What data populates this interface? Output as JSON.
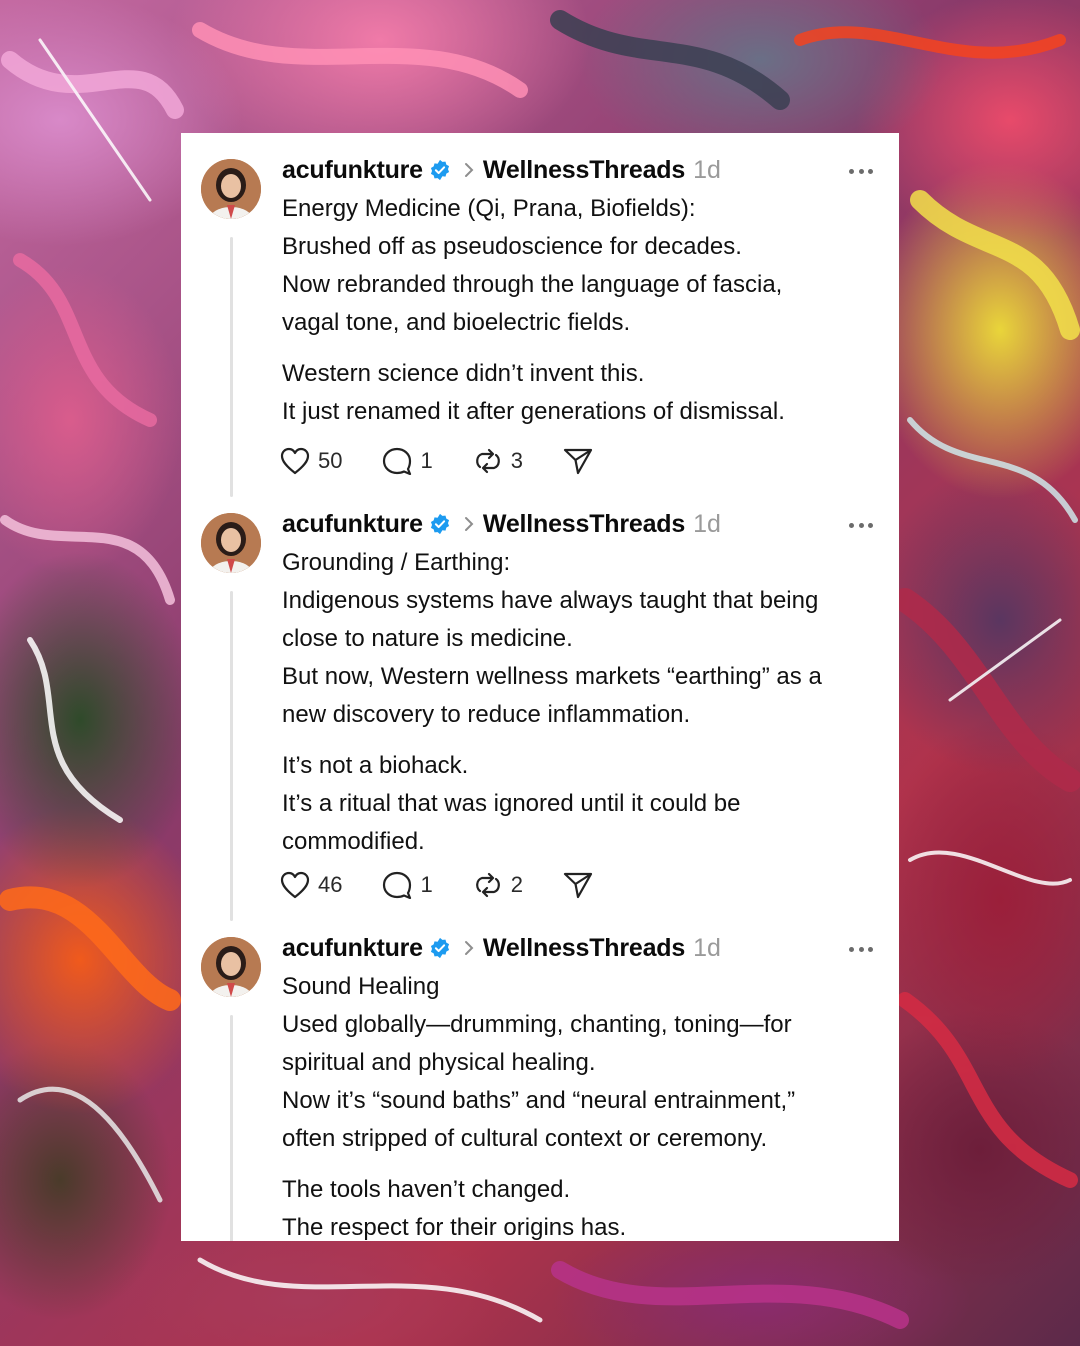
{
  "posts": [
    {
      "username": "acufunkture",
      "community": "WellnessThreads",
      "time": "1d",
      "lines": [
        "Energy Medicine (Qi, Prana, Biofields):",
        "Brushed off as pseudoscience for decades.",
        "Now rebranded through the language of fascia,",
        "vagal tone, and bioelectric fields.",
        "",
        "Western science didn’t invent this.",
        "It just renamed it after generations of dismissal."
      ],
      "likes": "50",
      "replies": "1",
      "reposts": "3"
    },
    {
      "username": "acufunkture",
      "community": "WellnessThreads",
      "time": "1d",
      "lines": [
        "Grounding / Earthing:",
        "Indigenous systems have always taught that being",
        "close to nature is medicine.",
        "But now, Western wellness markets “earthing” as a",
        "new discovery to reduce inflammation.",
        "",
        "It’s not a biohack.",
        "It’s a ritual that was ignored until it could be",
        "commodified."
      ],
      "likes": "46",
      "replies": "1",
      "reposts": "2"
    },
    {
      "username": "acufunkture",
      "community": "WellnessThreads",
      "time": "1d",
      "lines": [
        "Sound Healing",
        "Used globally—drumming, chanting, toning—for",
        "spiritual and physical healing.",
        "Now it’s “sound baths” and “neural entrainment,”",
        "often stripped of cultural context or ceremony.",
        "",
        "The tools haven’t changed.",
        "The respect for their origins has."
      ]
    }
  ],
  "icons": {
    "verified": "verified-badge-icon",
    "chevron": "chevron-right-icon",
    "more": "more-options-icon",
    "like": "heart-icon",
    "reply": "comment-icon",
    "repost": "repost-icon",
    "share": "send-icon"
  },
  "colors": {
    "verified": "#1d9bf0",
    "muted": "#9a9a9a",
    "text": "#111111"
  }
}
